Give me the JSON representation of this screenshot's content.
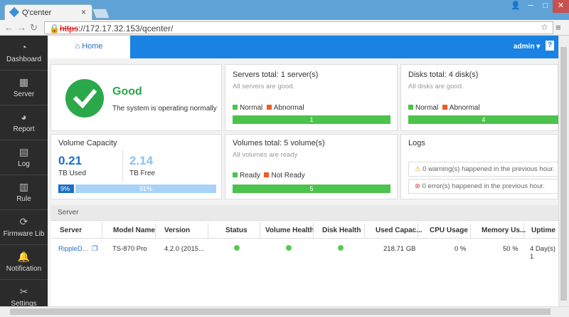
{
  "browser": {
    "tab_title": "Q'center",
    "tab_close": "×",
    "url_prefix": "https",
    "url_rest": "://172.17.32.153/qcenter/"
  },
  "sidebar": {
    "items": [
      {
        "label": "Dashboard",
        "icon": "dashboard-icon"
      },
      {
        "label": "Server",
        "icon": "server-icon"
      },
      {
        "label": "Report",
        "icon": "report-icon"
      },
      {
        "label": "Log",
        "icon": "log-icon"
      },
      {
        "label": "Rule",
        "icon": "rule-icon"
      },
      {
        "label": "Firmware Lib",
        "icon": "firmware-icon"
      },
      {
        "label": "Notification",
        "icon": "notification-icon"
      },
      {
        "label": "Settings",
        "icon": "settings-icon"
      }
    ]
  },
  "header": {
    "home_tab": "Home",
    "user": "admin",
    "help": "?"
  },
  "status": {
    "title": "Good",
    "subtitle": "The system is operating normally"
  },
  "servers_card": {
    "title": "Servers total: 1 server(s)",
    "subtitle": "All servers are good.",
    "legend_normal": "Normal",
    "legend_abnormal": "Abnormal",
    "bar_value": "1"
  },
  "disks_card": {
    "title": "Disks total: 4 disk(s)",
    "subtitle": "All disks are good.",
    "legend_normal": "Normal",
    "legend_abnormal": "Abnormal",
    "bar_value": "4"
  },
  "capacity": {
    "title": "Volume Capacity",
    "used_value": "0.21",
    "used_label": "TB Used",
    "free_value": "2.14",
    "free_label": "TB Free",
    "used_pct_label": "9%",
    "free_pct_label": "91%",
    "used_fraction": 0.09
  },
  "volumes_card": {
    "title": "Volumes total: 5 volume(s)",
    "subtitle": "All volumes are ready",
    "legend_ready": "Ready",
    "legend_not_ready": "Not Ready",
    "bar_value": "5"
  },
  "logs": {
    "title": "Logs",
    "warnings": "0 warning(s) happened in the previous hour.",
    "errors": "0 error(s) happened in the previous hour."
  },
  "server_table": {
    "section_title": "Server",
    "columns": [
      "Server",
      "Model Name",
      "Version",
      "Status",
      "Volume Health",
      "Disk Health",
      "Used Capac...",
      "CPU Usage",
      "Memory Us...",
      "Uptime"
    ],
    "row": {
      "server": "RippleD...",
      "model": "TS-870 Pro",
      "version": "4.2.0 (2015...",
      "used": "218.71 GB",
      "cpu": "0 %",
      "memory": "50 %",
      "uptime": "4 Day(s) 1"
    }
  },
  "colors": {
    "accent": "#1a82e2",
    "good": "#2ba84a",
    "normal": "#4cc34c",
    "abnormal": "#f05a28"
  }
}
